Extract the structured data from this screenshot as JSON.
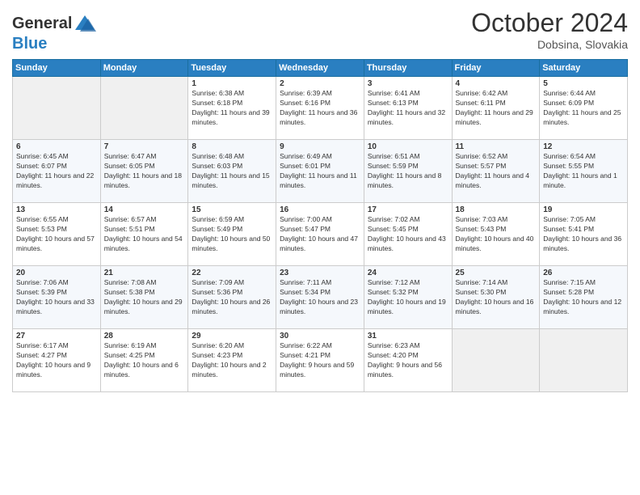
{
  "header": {
    "logo_line1": "General",
    "logo_line2": "Blue",
    "month": "October 2024",
    "location": "Dobsina, Slovakia"
  },
  "days_of_week": [
    "Sunday",
    "Monday",
    "Tuesday",
    "Wednesday",
    "Thursday",
    "Friday",
    "Saturday"
  ],
  "weeks": [
    [
      {
        "day": "",
        "sunrise": "",
        "sunset": "",
        "daylight": "",
        "empty": true
      },
      {
        "day": "",
        "sunrise": "",
        "sunset": "",
        "daylight": "",
        "empty": true
      },
      {
        "day": "1",
        "sunrise": "Sunrise: 6:38 AM",
        "sunset": "Sunset: 6:18 PM",
        "daylight": "Daylight: 11 hours and 39 minutes."
      },
      {
        "day": "2",
        "sunrise": "Sunrise: 6:39 AM",
        "sunset": "Sunset: 6:16 PM",
        "daylight": "Daylight: 11 hours and 36 minutes."
      },
      {
        "day": "3",
        "sunrise": "Sunrise: 6:41 AM",
        "sunset": "Sunset: 6:13 PM",
        "daylight": "Daylight: 11 hours and 32 minutes."
      },
      {
        "day": "4",
        "sunrise": "Sunrise: 6:42 AM",
        "sunset": "Sunset: 6:11 PM",
        "daylight": "Daylight: 11 hours and 29 minutes."
      },
      {
        "day": "5",
        "sunrise": "Sunrise: 6:44 AM",
        "sunset": "Sunset: 6:09 PM",
        "daylight": "Daylight: 11 hours and 25 minutes."
      }
    ],
    [
      {
        "day": "6",
        "sunrise": "Sunrise: 6:45 AM",
        "sunset": "Sunset: 6:07 PM",
        "daylight": "Daylight: 11 hours and 22 minutes."
      },
      {
        "day": "7",
        "sunrise": "Sunrise: 6:47 AM",
        "sunset": "Sunset: 6:05 PM",
        "daylight": "Daylight: 11 hours and 18 minutes."
      },
      {
        "day": "8",
        "sunrise": "Sunrise: 6:48 AM",
        "sunset": "Sunset: 6:03 PM",
        "daylight": "Daylight: 11 hours and 15 minutes."
      },
      {
        "day": "9",
        "sunrise": "Sunrise: 6:49 AM",
        "sunset": "Sunset: 6:01 PM",
        "daylight": "Daylight: 11 hours and 11 minutes."
      },
      {
        "day": "10",
        "sunrise": "Sunrise: 6:51 AM",
        "sunset": "Sunset: 5:59 PM",
        "daylight": "Daylight: 11 hours and 8 minutes."
      },
      {
        "day": "11",
        "sunrise": "Sunrise: 6:52 AM",
        "sunset": "Sunset: 5:57 PM",
        "daylight": "Daylight: 11 hours and 4 minutes."
      },
      {
        "day": "12",
        "sunrise": "Sunrise: 6:54 AM",
        "sunset": "Sunset: 5:55 PM",
        "daylight": "Daylight: 11 hours and 1 minute."
      }
    ],
    [
      {
        "day": "13",
        "sunrise": "Sunrise: 6:55 AM",
        "sunset": "Sunset: 5:53 PM",
        "daylight": "Daylight: 10 hours and 57 minutes."
      },
      {
        "day": "14",
        "sunrise": "Sunrise: 6:57 AM",
        "sunset": "Sunset: 5:51 PM",
        "daylight": "Daylight: 10 hours and 54 minutes."
      },
      {
        "day": "15",
        "sunrise": "Sunrise: 6:59 AM",
        "sunset": "Sunset: 5:49 PM",
        "daylight": "Daylight: 10 hours and 50 minutes."
      },
      {
        "day": "16",
        "sunrise": "Sunrise: 7:00 AM",
        "sunset": "Sunset: 5:47 PM",
        "daylight": "Daylight: 10 hours and 47 minutes."
      },
      {
        "day": "17",
        "sunrise": "Sunrise: 7:02 AM",
        "sunset": "Sunset: 5:45 PM",
        "daylight": "Daylight: 10 hours and 43 minutes."
      },
      {
        "day": "18",
        "sunrise": "Sunrise: 7:03 AM",
        "sunset": "Sunset: 5:43 PM",
        "daylight": "Daylight: 10 hours and 40 minutes."
      },
      {
        "day": "19",
        "sunrise": "Sunrise: 7:05 AM",
        "sunset": "Sunset: 5:41 PM",
        "daylight": "Daylight: 10 hours and 36 minutes."
      }
    ],
    [
      {
        "day": "20",
        "sunrise": "Sunrise: 7:06 AM",
        "sunset": "Sunset: 5:39 PM",
        "daylight": "Daylight: 10 hours and 33 minutes."
      },
      {
        "day": "21",
        "sunrise": "Sunrise: 7:08 AM",
        "sunset": "Sunset: 5:38 PM",
        "daylight": "Daylight: 10 hours and 29 minutes."
      },
      {
        "day": "22",
        "sunrise": "Sunrise: 7:09 AM",
        "sunset": "Sunset: 5:36 PM",
        "daylight": "Daylight: 10 hours and 26 minutes."
      },
      {
        "day": "23",
        "sunrise": "Sunrise: 7:11 AM",
        "sunset": "Sunset: 5:34 PM",
        "daylight": "Daylight: 10 hours and 23 minutes."
      },
      {
        "day": "24",
        "sunrise": "Sunrise: 7:12 AM",
        "sunset": "Sunset: 5:32 PM",
        "daylight": "Daylight: 10 hours and 19 minutes."
      },
      {
        "day": "25",
        "sunrise": "Sunrise: 7:14 AM",
        "sunset": "Sunset: 5:30 PM",
        "daylight": "Daylight: 10 hours and 16 minutes."
      },
      {
        "day": "26",
        "sunrise": "Sunrise: 7:15 AM",
        "sunset": "Sunset: 5:28 PM",
        "daylight": "Daylight: 10 hours and 12 minutes."
      }
    ],
    [
      {
        "day": "27",
        "sunrise": "Sunrise: 6:17 AM",
        "sunset": "Sunset: 4:27 PM",
        "daylight": "Daylight: 10 hours and 9 minutes."
      },
      {
        "day": "28",
        "sunrise": "Sunrise: 6:19 AM",
        "sunset": "Sunset: 4:25 PM",
        "daylight": "Daylight: 10 hours and 6 minutes."
      },
      {
        "day": "29",
        "sunrise": "Sunrise: 6:20 AM",
        "sunset": "Sunset: 4:23 PM",
        "daylight": "Daylight: 10 hours and 2 minutes."
      },
      {
        "day": "30",
        "sunrise": "Sunrise: 6:22 AM",
        "sunset": "Sunset: 4:21 PM",
        "daylight": "Daylight: 9 hours and 59 minutes."
      },
      {
        "day": "31",
        "sunrise": "Sunrise: 6:23 AM",
        "sunset": "Sunset: 4:20 PM",
        "daylight": "Daylight: 9 hours and 56 minutes."
      },
      {
        "day": "",
        "sunrise": "",
        "sunset": "",
        "daylight": "",
        "empty": true
      },
      {
        "day": "",
        "sunrise": "",
        "sunset": "",
        "daylight": "",
        "empty": true
      }
    ]
  ]
}
